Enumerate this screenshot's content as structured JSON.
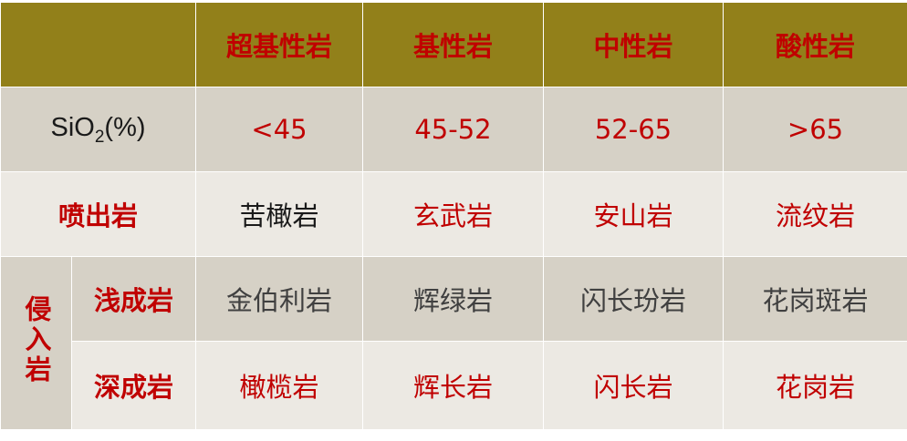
{
  "header": {
    "corner": "",
    "columns": [
      "超基性岩",
      "基性岩",
      "中性岩",
      "酸性岩"
    ]
  },
  "sio2_row": {
    "label_prefix": "SiO",
    "label_sub": "2",
    "label_suffix": "(%)",
    "values": [
      "<45",
      "45-52",
      "52-65",
      ">65"
    ]
  },
  "extrusive_row": {
    "label": "喷出岩",
    "values": [
      "苦橄岩",
      "玄武岩",
      "安山岩",
      "流纹岩"
    ]
  },
  "intrusive": {
    "label": "侵入岩",
    "shallow": {
      "label": "浅成岩",
      "values": [
        "金伯利岩",
        "辉绿岩",
        "闪长玢岩",
        "花岗斑岩"
      ]
    },
    "deep": {
      "label": "深成岩",
      "values": [
        "橄榄岩",
        "辉长岩",
        "闪长岩",
        "花岗岩"
      ]
    }
  },
  "colors": {
    "header_bg": "#92801a",
    "row_dark": "#d6d1c6",
    "row_light": "#ece9e3",
    "accent_red": "#c00000"
  }
}
